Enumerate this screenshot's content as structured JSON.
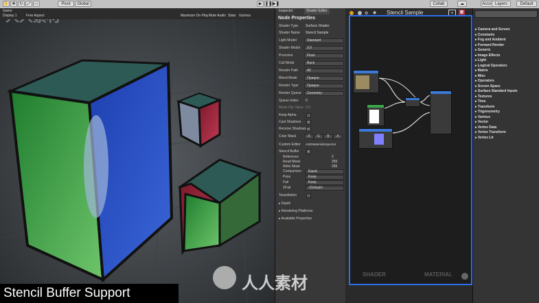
{
  "toolbar": {
    "pivot": "Pivot",
    "global": "Global",
    "collab": "Collab",
    "account": "Account",
    "layers": "Layers",
    "layout": "Default"
  },
  "game": {
    "tab": "Game",
    "display": "Display 1",
    "aspect": "Free Aspect",
    "maximize": "Maximize On Play",
    "mute": "Mute Audio",
    "stats": "Stats",
    "gizmos": "Gizmos"
  },
  "tabs": {
    "inspector": "Inspector",
    "shader_editor": "Shader Editor"
  },
  "graph_title": "Stencil Sample",
  "node_properties": {
    "title": "Node Properties",
    "rows": [
      {
        "label": "Shader Type",
        "value": "Surface Shader"
      },
      {
        "label": "Shader Name",
        "value": "Stencil Sample"
      },
      {
        "label": "Light Model",
        "value": "Standard"
      },
      {
        "label": "Shader Model",
        "value": "3.0"
      },
      {
        "label": "Precision",
        "value": "Float"
      },
      {
        "label": "Cull Mode",
        "value": "Back"
      },
      {
        "label": "Render Path",
        "value": "All"
      },
      {
        "label": "Blend Mode",
        "value": "Opaque"
      },
      {
        "label": "Render Type",
        "value": "Opaque"
      },
      {
        "label": "Render Queue",
        "value": "Geometry"
      },
      {
        "label": "Queue Index",
        "value": "0"
      },
      {
        "label": "Mask Clip Value",
        "value": "0.5"
      }
    ],
    "checks": [
      {
        "label": "Keep Alpha"
      },
      {
        "label": "Cast Shadows"
      },
      {
        "label": "Receive Shadows"
      }
    ],
    "color_mask": {
      "label": "Color Mask",
      "channels": [
        "R",
        "G",
        "B",
        "A"
      ]
    },
    "custom_editor": {
      "label": "Custom Editor",
      "value": "ASEMaterialInspector"
    },
    "stencil": {
      "label": "Stencil Buffer",
      "rows": [
        {
          "label": "Reference",
          "value": "2"
        },
        {
          "label": "Read Mask",
          "value": "255"
        },
        {
          "label": "Write Mask",
          "value": "255"
        },
        {
          "label": "Comparison",
          "value": "Equal"
        },
        {
          "label": "Pass",
          "value": "Keep"
        },
        {
          "label": "Fail",
          "value": "Keep"
        },
        {
          "label": "ZFail",
          "value": "<Default>"
        }
      ]
    },
    "tessellation": "Tessellation",
    "foldouts": [
      "Depth",
      "Rendering Platforms",
      "Available Properties"
    ]
  },
  "graph": {
    "shader_label": "SHADER",
    "material_label": "MATERIAL"
  },
  "categories": [
    "Camera and Screen",
    "Constants",
    "Fog and Ambient",
    "Forward Render",
    "Generic",
    "Image Effects",
    "Light",
    "Logical Operators",
    "Matrix",
    "Misc",
    "Operators",
    "Screen Space",
    "Surface Standard Inputs",
    "Textures",
    "Time",
    "Transform",
    "Trigonometry",
    "Various",
    "Vector",
    "Vertex Data",
    "Vertex Transform",
    "Vertex Lit"
  ],
  "caption": "Stencil Buffer Support",
  "watermark": "人人素材",
  "colors": {
    "accent": "#2d6fe8",
    "caption_bg": "#000000"
  }
}
